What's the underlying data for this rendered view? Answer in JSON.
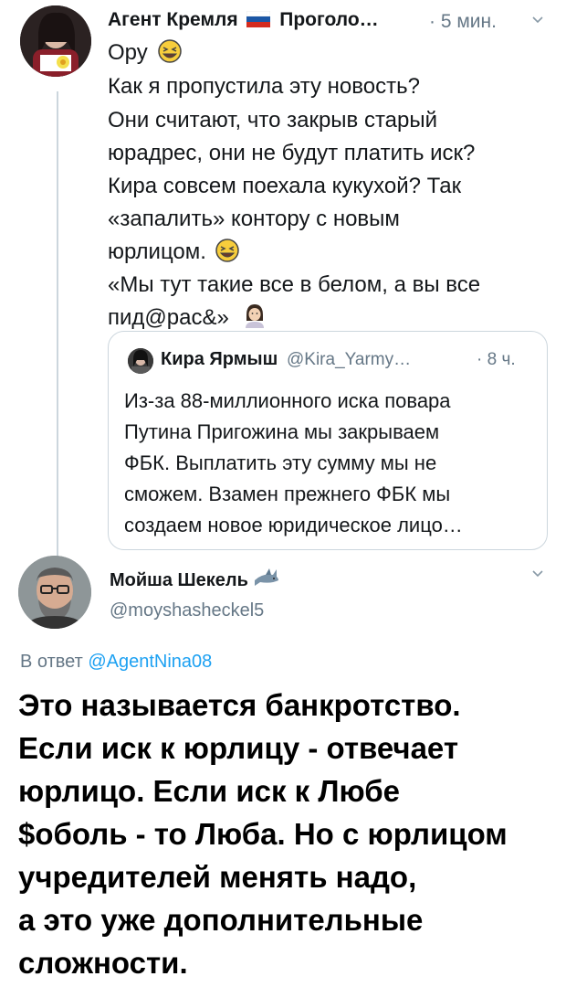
{
  "tweet1": {
    "name": "Агент Кремля",
    "flag_icon": "russia-flag-icon",
    "name_rest": "Проголо…",
    "dot": "·",
    "time": "5 мин.",
    "lines": [
      "Ору",
      "Как я пропустила эту новость?",
      "Они считают, что закрыв старый",
      "юрадрес, они не будут платить иск?",
      "Кира совсем поехала кукухой? Так",
      "«запалить» контору с новым",
      "юрлицом.",
      "«Мы тут такие все в белом, а вы все",
      "пид@рас&»"
    ],
    "emoji_laugh": "laughing-face-emoji",
    "emoji_woman": "woman-emoji"
  },
  "quote": {
    "name": "Кира Ярмыш",
    "handle": "@Kira_Yarmy…",
    "dot": "·",
    "time": "8 ч.",
    "lines": [
      "Из-за 88-миллионного иска повара",
      "Путина Пригожина мы закрываем",
      "ФБК. Выплатить эту сумму мы не",
      "сможем. Взамен прежнего ФБК мы",
      "создаем новое юридическое лицо…"
    ]
  },
  "tweet2": {
    "name": "Мойша Шекель",
    "emoji": "shark-emoji",
    "handle": "@moyshasheckel5",
    "reply_prefix": "В ответ",
    "reply_to": "@AgentNina08",
    "lines": [
      "Это называется банкротство.",
      "Если иск к юрлицу - отвечает",
      "юрлицо. Если иск к Любе",
      "$оболь - то Люба. Но с юрлицом",
      "учредителей менять надо,",
      "а это уже дополнительные",
      "сложности."
    ]
  },
  "colors": {
    "text": "#14171a",
    "secondary": "#657786",
    "link": "#1da1f2",
    "border": "#ccd6dd"
  }
}
